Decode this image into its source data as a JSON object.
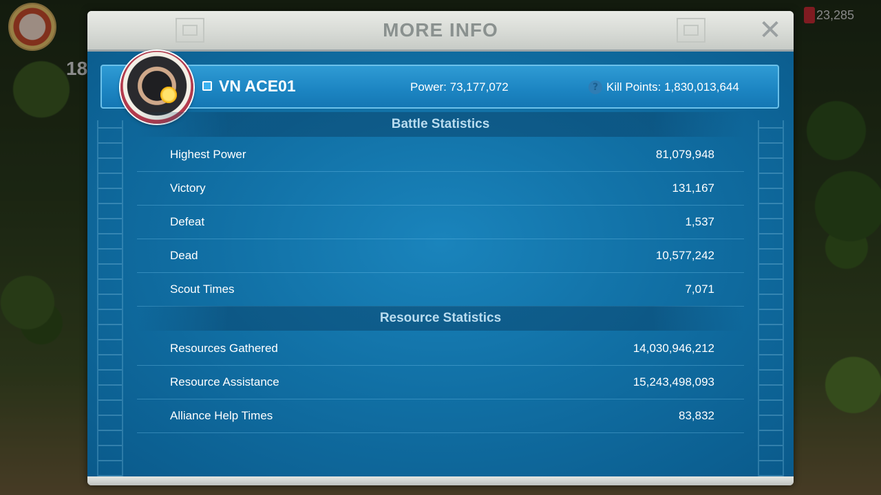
{
  "background": {
    "level": "18",
    "gems": "23,285"
  },
  "dialog": {
    "title": "MORE INFO",
    "close_icon": "close-icon"
  },
  "player": {
    "name": "VN ACE01",
    "power": "Power: 73,177,072",
    "kill_points": "Kill Points: 1,830,013,644",
    "help_icon": "?"
  },
  "battle": {
    "title": "Battle Statistics",
    "rows": [
      {
        "label": "Highest Power",
        "value": "81,079,948"
      },
      {
        "label": "Victory",
        "value": "131,167"
      },
      {
        "label": "Defeat",
        "value": "1,537"
      },
      {
        "label": "Dead",
        "value": "10,577,242"
      },
      {
        "label": "Scout Times",
        "value": "7,071"
      }
    ]
  },
  "resource": {
    "title": "Resource Statistics",
    "rows": [
      {
        "label": "Resources Gathered",
        "value": "14,030,946,212"
      },
      {
        "label": "Resource Assistance",
        "value": "15,243,498,093"
      },
      {
        "label": "Alliance Help Times",
        "value": "83,832"
      }
    ]
  },
  "colors": {
    "panel_blue": "#1170a5",
    "header_gray": "#d6d9d4",
    "title_gray": "#8a918f",
    "section_text": "#b9dcef"
  }
}
